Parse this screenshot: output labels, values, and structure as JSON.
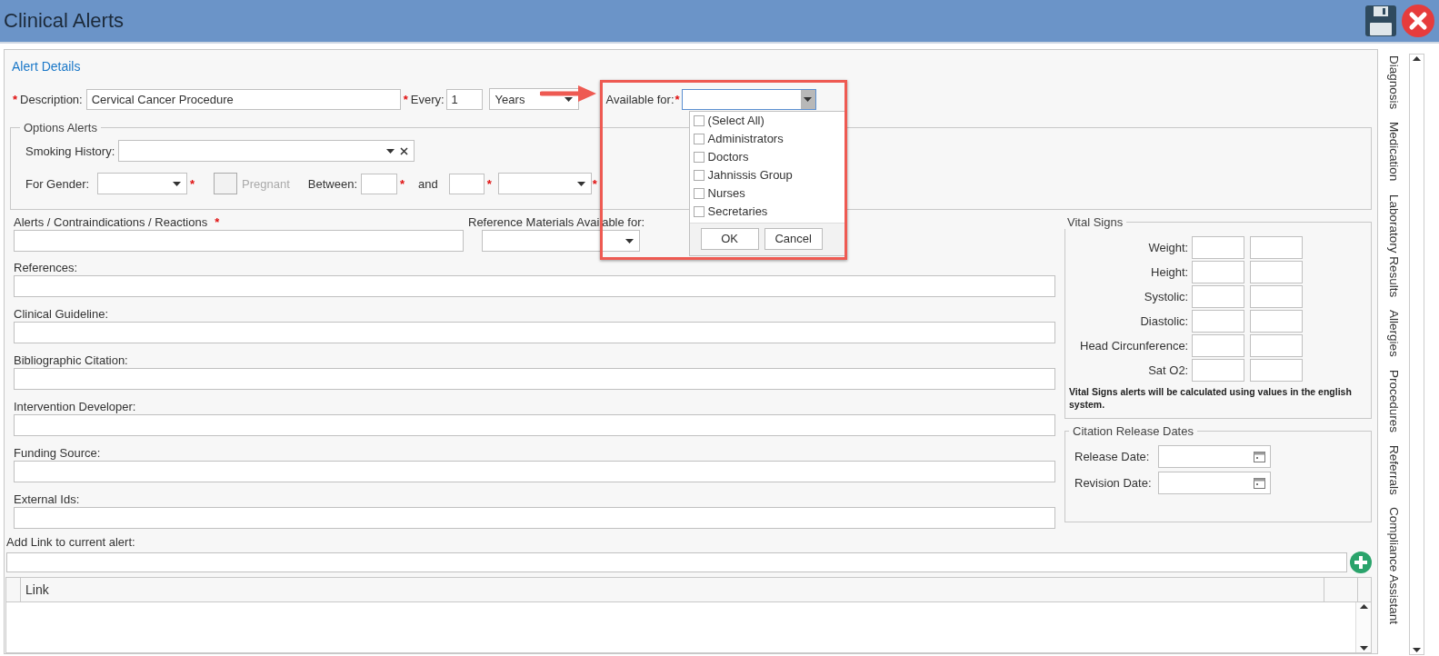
{
  "window": {
    "title": "Clinical Alerts"
  },
  "required_mark": "*",
  "section_title": "Alert Details",
  "description": {
    "label": "Description:",
    "value": "Cervical Cancer Procedure",
    "required": true
  },
  "every": {
    "label": "Every:",
    "value": "1",
    "required": true
  },
  "unit": {
    "value": "Years"
  },
  "available_for": {
    "label": "Available for:",
    "required": true,
    "expanded": true,
    "options": [
      {
        "label": "(Select All)",
        "checked": false
      },
      {
        "label": "Administrators",
        "checked": false
      },
      {
        "label": "Doctors",
        "checked": false
      },
      {
        "label": "Jahnissis Group",
        "checked": false
      },
      {
        "label": "Nurses",
        "checked": false
      },
      {
        "label": "Secretaries",
        "checked": false
      }
    ],
    "buttons": [
      "OK",
      "Cancel"
    ]
  },
  "options_alerts": {
    "title": "Options Alerts",
    "smoking_history": {
      "label": "Smoking History:"
    },
    "gender": {
      "label": "For Gender:",
      "required": true
    },
    "pregnant": {
      "label": "Pregnant",
      "checked": false,
      "disabled": true
    },
    "between": {
      "label": "Between:",
      "required": true
    },
    "and": {
      "label": "and",
      "required": true
    },
    "age_unit": {
      "required": true
    }
  },
  "alerts_field": {
    "label": "Alerts / Contraindications / Reactions",
    "required": true
  },
  "reference_materials": {
    "label": "Reference Materials Available for:"
  },
  "text_fields": [
    {
      "label": "References:"
    },
    {
      "label": "Clinical Guideline:"
    },
    {
      "label": "Bibliographic Citation:"
    },
    {
      "label": "Intervention Developer:"
    },
    {
      "label": "Funding Source:"
    },
    {
      "label": "External Ids:"
    }
  ],
  "vital_signs": {
    "title": "Vital Signs",
    "rows": [
      {
        "label": "Weight:"
      },
      {
        "label": "Height:"
      },
      {
        "label": "Systolic:"
      },
      {
        "label": "Diastolic:"
      },
      {
        "label": "Head Circunference:"
      },
      {
        "label": "Sat O2:"
      }
    ],
    "note": "Vital Signs alerts will be calculated using values in the english system."
  },
  "citation_dates": {
    "title": "Citation Release Dates",
    "fields": [
      {
        "label": "Release Date:"
      },
      {
        "label": "Revision Date:"
      }
    ]
  },
  "add_link": {
    "label": "Add Link to current alert:"
  },
  "link_table": {
    "columns": [
      "Link"
    ]
  },
  "side_tabs": [
    {
      "label": "Diagnosis"
    },
    {
      "label": "Medication"
    },
    {
      "label": "Laboratory Results"
    },
    {
      "label": "Allergies"
    },
    {
      "label": "Procedures"
    },
    {
      "label": "Referrals"
    },
    {
      "label": "Compliance Assistant"
    }
  ]
}
